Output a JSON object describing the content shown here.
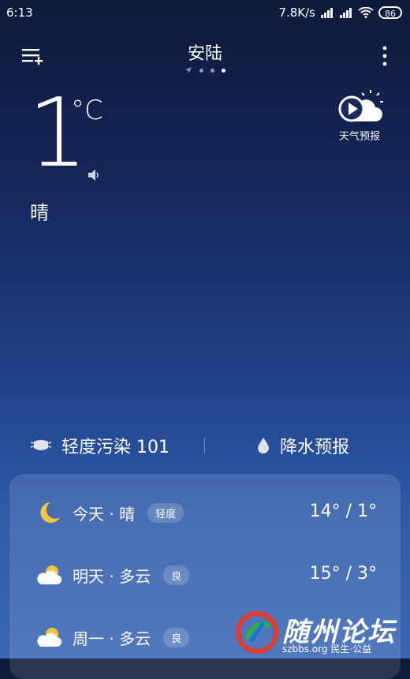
{
  "status": {
    "time": "6:13",
    "net_speed": "7.8K/s",
    "battery": "86"
  },
  "header": {
    "city": "安陆",
    "menu_icon": "menu-add-icon",
    "more_icon": "more-vert-icon"
  },
  "current": {
    "temperature": "1",
    "unit": "°C",
    "condition": "晴",
    "forecast_label": "天气预报"
  },
  "info": {
    "aqi_text": "轻度污染 101",
    "rain_text": "降水预报"
  },
  "daily": [
    {
      "label": "今天 · 晴",
      "badge": "轻度",
      "temps": "14° / 1°",
      "icon": "moon-icon"
    },
    {
      "label": "明天 · 多云",
      "badge": "良",
      "temps": "15° / 3°",
      "icon": "cloud-sun-icon"
    },
    {
      "label": "周一 · 多云",
      "badge": "良",
      "temps": "",
      "icon": "cloud-sun-icon"
    }
  ],
  "watermark": {
    "brand": "随州论坛",
    "sub": "szbbs.org 民生·公益"
  },
  "colors": {
    "accent_moon": "#f4c542",
    "bg_top": "#0f1a3a",
    "bg_bottom": "#3a66b4"
  }
}
